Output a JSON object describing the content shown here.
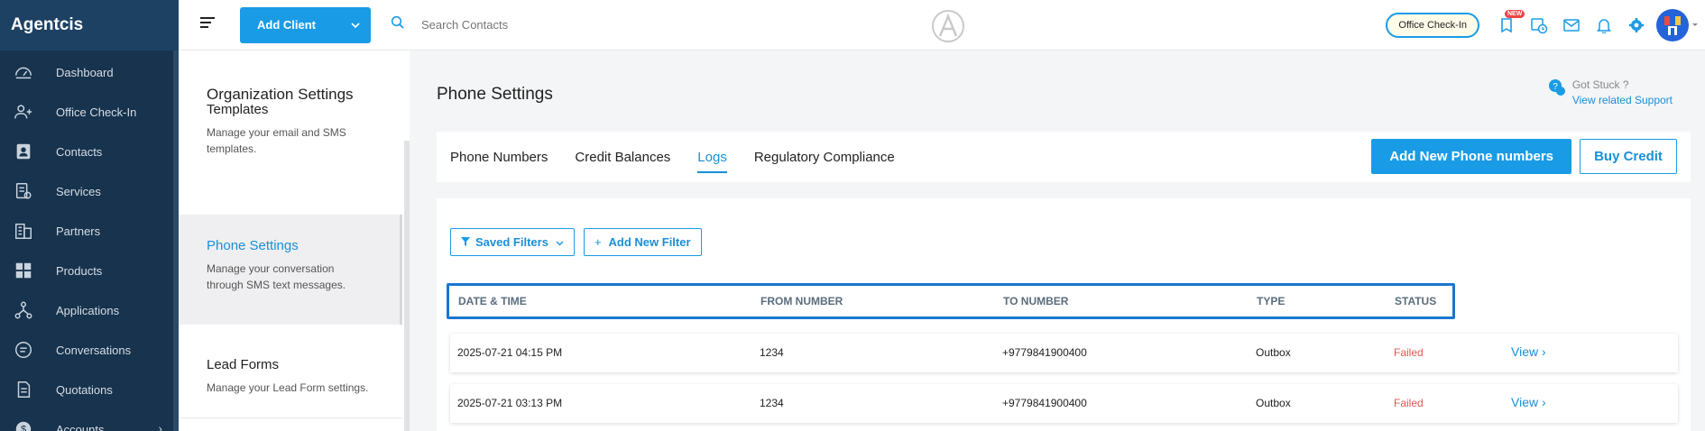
{
  "brand": "Agentcis",
  "sidebar": {
    "items": [
      {
        "label": "Dashboard",
        "icon": "dashboard-icon"
      },
      {
        "label": "Office Check-In",
        "icon": "office-checkin-icon"
      },
      {
        "label": "Contacts",
        "icon": "contacts-icon"
      },
      {
        "label": "Services",
        "icon": "services-icon"
      },
      {
        "label": "Partners",
        "icon": "partners-icon"
      },
      {
        "label": "Products",
        "icon": "products-icon"
      },
      {
        "label": "Applications",
        "icon": "applications-icon"
      },
      {
        "label": "Conversations",
        "icon": "conversations-icon"
      },
      {
        "label": "Quotations",
        "icon": "quotations-icon"
      },
      {
        "label": "Accounts",
        "icon": "accounts-icon"
      }
    ]
  },
  "topbar": {
    "add_client_label": "Add Client",
    "search_placeholder": "Search Contacts",
    "office_checkin_label": "Office Check-In",
    "new_badge": "NEW"
  },
  "settings": {
    "title": "Organization Settings",
    "items": [
      {
        "title": "Templates",
        "desc": "Manage your email and SMS templates."
      },
      {
        "title": "Phone Settings",
        "desc": "Manage your conversation through SMS text messages.",
        "active": true
      },
      {
        "title": "Lead Forms",
        "desc": "Manage your Lead Form settings."
      }
    ]
  },
  "main": {
    "title": "Phone Settings",
    "support": {
      "question": "Got Stuck ?",
      "link": "View related Support"
    },
    "tabs": [
      "Phone Numbers",
      "Credit Balances",
      "Logs",
      "Regulatory Compliance"
    ],
    "active_tab": "Logs",
    "add_phone_label": "Add New Phone numbers",
    "buy_credit_label": "Buy Credit",
    "saved_filters_label": "Saved Filters",
    "add_filter_label": "Add New Filter",
    "columns": [
      "DATE & TIME",
      "FROM NUMBER",
      "TO NUMBER",
      "TYPE",
      "STATUS"
    ],
    "rows": [
      {
        "datetime": "2025-07-21 04:15 PM",
        "from": "1234",
        "to": "+9779841900400",
        "type": "Outbox",
        "status": "Failed",
        "action": "View"
      },
      {
        "datetime": "2025-07-21 03:13 PM",
        "from": "1234",
        "to": "+9779841900400",
        "type": "Outbox",
        "status": "Failed",
        "action": "View"
      }
    ]
  },
  "colors": {
    "accent": "#1a9be6",
    "sidebar": "#17334d",
    "failed": "#e0574f"
  }
}
